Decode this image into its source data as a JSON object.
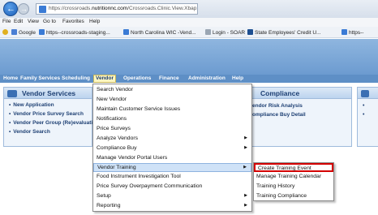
{
  "browser": {
    "url_prefix": "https://crossroads.",
    "url_domain": "nutritionnc.com",
    "url_suffix": "/Crossroads.Clinic.View.Xbap"
  },
  "menu_bar": [
    "File",
    "Edit",
    "View",
    "Go to",
    "Favorites",
    "Help"
  ],
  "favorites": [
    {
      "label": "Google",
      "icon": "google-icon"
    },
    {
      "label": "https--crossroads-staging...",
      "icon": "ie-page-icon"
    },
    {
      "label": "North Carolina WIC -Vend...",
      "icon": "ie-page-icon"
    },
    {
      "label": "Login - SOAR",
      "icon": "page-icon"
    },
    {
      "label": "State Employees' Credit U...",
      "icon": "credit-union-icon"
    },
    {
      "label": "https--",
      "icon": "ie-page-icon"
    }
  ],
  "app_nav": [
    "Home",
    "Family Services",
    "Scheduling",
    "Vendor",
    "Operations",
    "Finance",
    "Administration",
    "Help"
  ],
  "vendor_services": {
    "title": "Vendor Services",
    "items": [
      "New Application",
      "Vendor Price Survey Search",
      "Vendor Peer Group (Re)evaluation",
      "Vendor Search"
    ]
  },
  "compliance": {
    "title": "Compliance",
    "items": [
      "endor Risk Analysis",
      "ompliance Buy Detail"
    ]
  },
  "vendor_menu": [
    {
      "label": "Search Vendor",
      "has_sub": false
    },
    {
      "label": "New Vendor",
      "has_sub": false
    },
    {
      "label": "Maintain Customer Service Issues",
      "has_sub": false
    },
    {
      "label": "Notifications",
      "has_sub": false
    },
    {
      "label": "Price Surveys",
      "has_sub": false
    },
    {
      "label": "Analyze Vendors",
      "has_sub": true
    },
    {
      "label": "Compliance Buy",
      "has_sub": true
    },
    {
      "label": "Manage Vendor Portal Users",
      "has_sub": false
    },
    {
      "label": "Vendor Training",
      "has_sub": true
    },
    {
      "label": "Food Instrument Investigation Tool",
      "has_sub": false
    },
    {
      "label": "Price Survey Overpayment Communication",
      "has_sub": false
    },
    {
      "label": "Setup",
      "has_sub": true
    },
    {
      "label": "Reporting",
      "has_sub": true
    }
  ],
  "vendor_training_menu": [
    "Create Training Event",
    "Manage Training Calendar",
    "Training History",
    "Training Compliance"
  ],
  "colors": {
    "highlight_border": "#d40000",
    "nav_bg": "#5e8fc6",
    "active_tab": "#fff7c2"
  }
}
